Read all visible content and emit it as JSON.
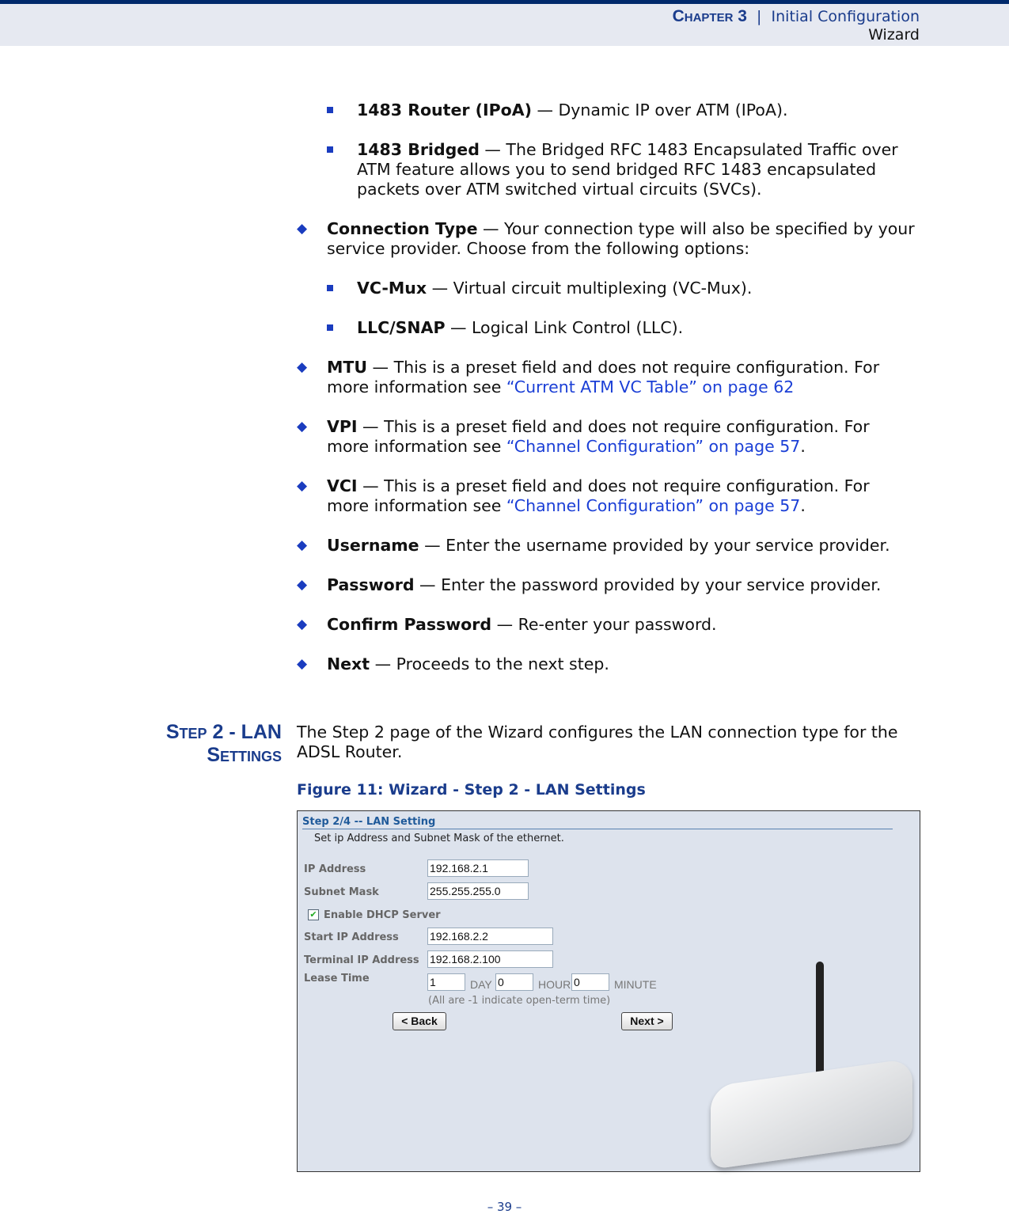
{
  "header": {
    "chapter": "Chapter 3",
    "separator": "|",
    "title_line1": "Initial Configuration",
    "title_line2": "Wizard"
  },
  "items": [
    {
      "term": "1483 Router (IPoA)",
      "text": " — Dynamic IP over ATM (IPoA)."
    },
    {
      "term": "1483 Bridged",
      "text": " — The Bridged RFC 1483 Encapsulated Traffic over ATM feature allows you to send bridged RFC 1483 encapsulated packets over ATM switched virtual circuits (SVCs)."
    },
    {
      "term": "Connection Type",
      "text": " — Your connection type will also be specified by your service provider. Choose from the following options:"
    },
    {
      "term": "VC-Mux",
      "text": " — Virtual circuit multiplexing (VC-Mux)."
    },
    {
      "term": "LLC/SNAP",
      "text": " — Logical Link Control (LLC)."
    },
    {
      "term": "MTU",
      "text": " — This is a preset field and does not require configuration. For more information see ",
      "link": "“Current ATM VC Table” on page 62"
    },
    {
      "term": "VPI",
      "text": " — This is a preset field and does not require configuration. For more information see ",
      "link": "“Channel Configuration” on page 57",
      "after": "."
    },
    {
      "term": "VCI",
      "text": " — This is a preset field and does not require configuration. For more information see ",
      "link": "“Channel Configuration” on page 57",
      "after": "."
    },
    {
      "term": "Username",
      "text": " — Enter the username provided by your service provider."
    },
    {
      "term": "Password",
      "text": " — Enter the password provided by your service provider."
    },
    {
      "term": "Confirm Password",
      "text": " — Re-enter your password."
    },
    {
      "term": "Next",
      "text": " — Proceeds to the next step."
    }
  ],
  "section": {
    "heading_line1": "Step 2 - LAN",
    "heading_line2": "Settings",
    "intro": "The Step 2 page of the Wizard configures the LAN connection type for the ADSL Router.",
    "figure_caption": "Figure 11:  Wizard - Step 2 - LAN Settings"
  },
  "screenshot": {
    "title": "Step 2/4 -- LAN Setting",
    "subtitle": "Set ip Address and Subnet Mask of the ethernet.",
    "ip_label": "IP Address",
    "ip_value": "192.168.2.1",
    "mask_label": "Subnet Mask",
    "mask_value": "255.255.255.0",
    "dhcp_label": "Enable DHCP Server",
    "dhcp_checked": true,
    "start_label": "Start IP Address",
    "start_value": "192.168.2.2",
    "end_label": "Terminal IP Address",
    "end_value": "192.168.2.100",
    "lease_label": "Lease Time",
    "lease_day": "1",
    "day_unit": "DAY",
    "lease_hour": "0",
    "hour_unit": "HOUR",
    "lease_minute": "0",
    "minute_unit": "MINUTE",
    "lease_note": "(All are -1 indicate open-term time)",
    "back_button": "< Back",
    "next_button": "Next >"
  },
  "page_number": "–  39  –"
}
